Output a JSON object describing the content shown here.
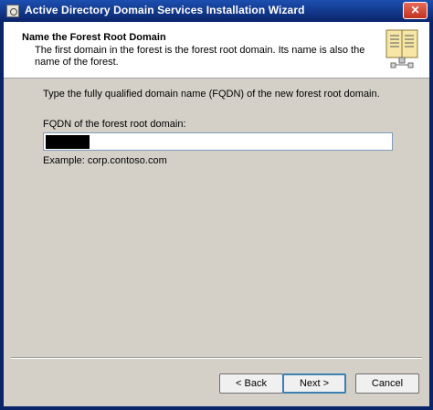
{
  "window": {
    "title": "Active Directory Domain Services Installation Wizard"
  },
  "header": {
    "title": "Name the Forest Root Domain",
    "description": "The first domain in the forest is the forest root domain. Its name is also the name of the forest."
  },
  "form": {
    "instruction": "Type the fully qualified domain name (FQDN) of the new forest root domain.",
    "fqdn_label": "FQDN of the forest root domain:",
    "example": "Example: corp.contoso.com"
  },
  "buttons": {
    "back": "< Back",
    "next": "Next >",
    "cancel": "Cancel"
  },
  "icons": {
    "app": "wizard-app-icon",
    "close": "close-icon",
    "header": "book-icon"
  }
}
